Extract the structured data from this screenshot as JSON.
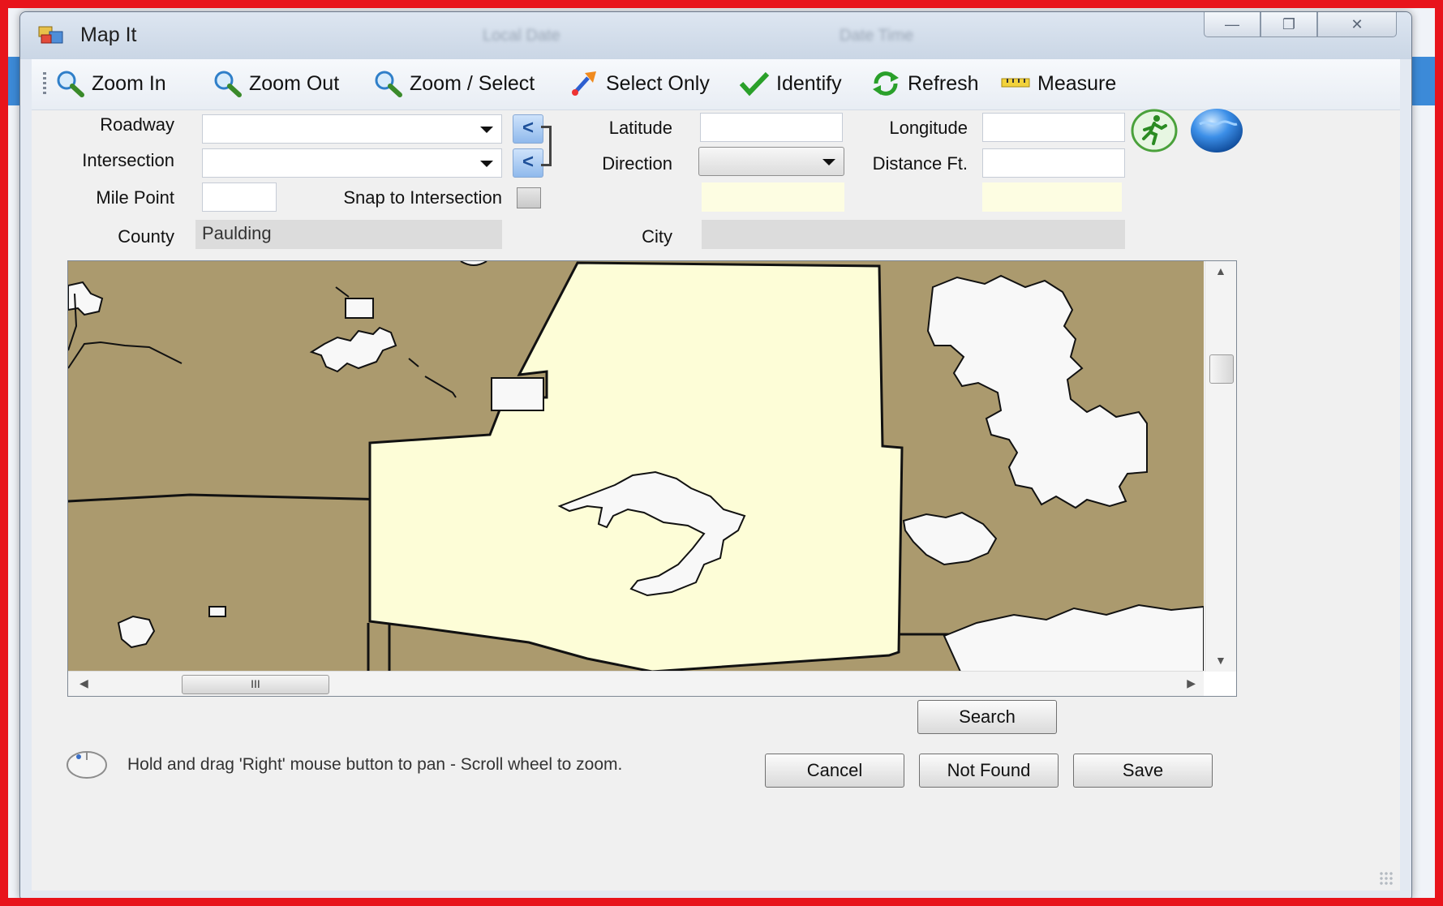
{
  "window": {
    "title": "Map It",
    "background_text_1": "Local Date",
    "background_text_2": "Date Time"
  },
  "toolbar": {
    "zoom_in": "Zoom In",
    "zoom_out": "Zoom Out",
    "zoom_select": "Zoom / Select",
    "select_only": "Select Only",
    "identify": "Identify",
    "refresh": "Refresh",
    "measure": "Measure"
  },
  "form": {
    "roadway_label": "Roadway",
    "roadway_value": "",
    "intersection_label": "Intersection",
    "intersection_value": "",
    "mile_point_label": "Mile Point",
    "mile_point_value": "",
    "snap_label": "Snap to Intersection",
    "snap_checked": false,
    "county_label": "County",
    "county_value": "Paulding",
    "latitude_label": "Latitude",
    "latitude_value": "",
    "direction_label": "Direction",
    "direction_value": "",
    "city_label": "City",
    "city_value": "",
    "longitude_label": "Longitude",
    "longitude_value": "",
    "distance_label": "Distance Ft.",
    "distance_value": "",
    "back_symbol": "<"
  },
  "map": {
    "land_color": "#ab9a6e",
    "selected_county_color": "#fdfdd7",
    "urban_color": "#f8f8f8",
    "scroll_thumb_text": "III"
  },
  "buttons": {
    "search": "Search",
    "cancel": "Cancel",
    "not_found": "Not Found",
    "save": "Save"
  },
  "hint": "Hold and drag 'Right' mouse button to pan - Scroll wheel to zoom."
}
